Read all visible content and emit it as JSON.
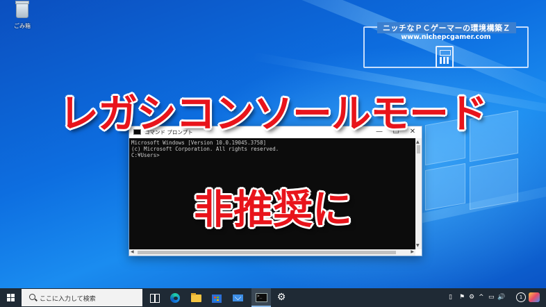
{
  "desktop": {
    "recycle_bin_label": "ごみ箱",
    "icons": [
      "recycle-bin-icon"
    ]
  },
  "brand": {
    "title": "ニッチなＰＣゲーマーの環境構築Ｚ",
    "url": "www.nichepcgamer.com",
    "icon": "pc-tower-icon"
  },
  "overlay": {
    "headline": "レガシコンソールモード",
    "subline": "非推奨に",
    "text_color": "#e8141b",
    "outline_color": "#ffffff"
  },
  "cmd_window": {
    "title": "コマンド プロンプト",
    "min_glyph": "—",
    "max_glyph": "☐",
    "close_glyph": "✕",
    "lines": [
      "Microsoft Windows [Version 10.0.19045.3758]",
      "(c) Microsoft Corporation. All rights reserved.",
      "",
      "C:¥Users>"
    ],
    "bg_color": "#0c0c0c",
    "text_color": "#cccccc"
  },
  "taskbar": {
    "search_placeholder": "ここに入力して検索",
    "pinned": [
      "task-view-icon",
      "edge-icon",
      "file-explorer-icon",
      "store-icon",
      "mail-icon",
      "command-prompt-icon",
      "settings-icon"
    ],
    "gear_glyph": "⚙",
    "tray": {
      "t1": "▯",
      "t2": "⚑",
      "t3": "⚙",
      "t4": "^",
      "t5": "▭",
      "t6": "🔊",
      "t7": "",
      "notification_count": "1"
    },
    "bg_color": "#1f2a35"
  }
}
